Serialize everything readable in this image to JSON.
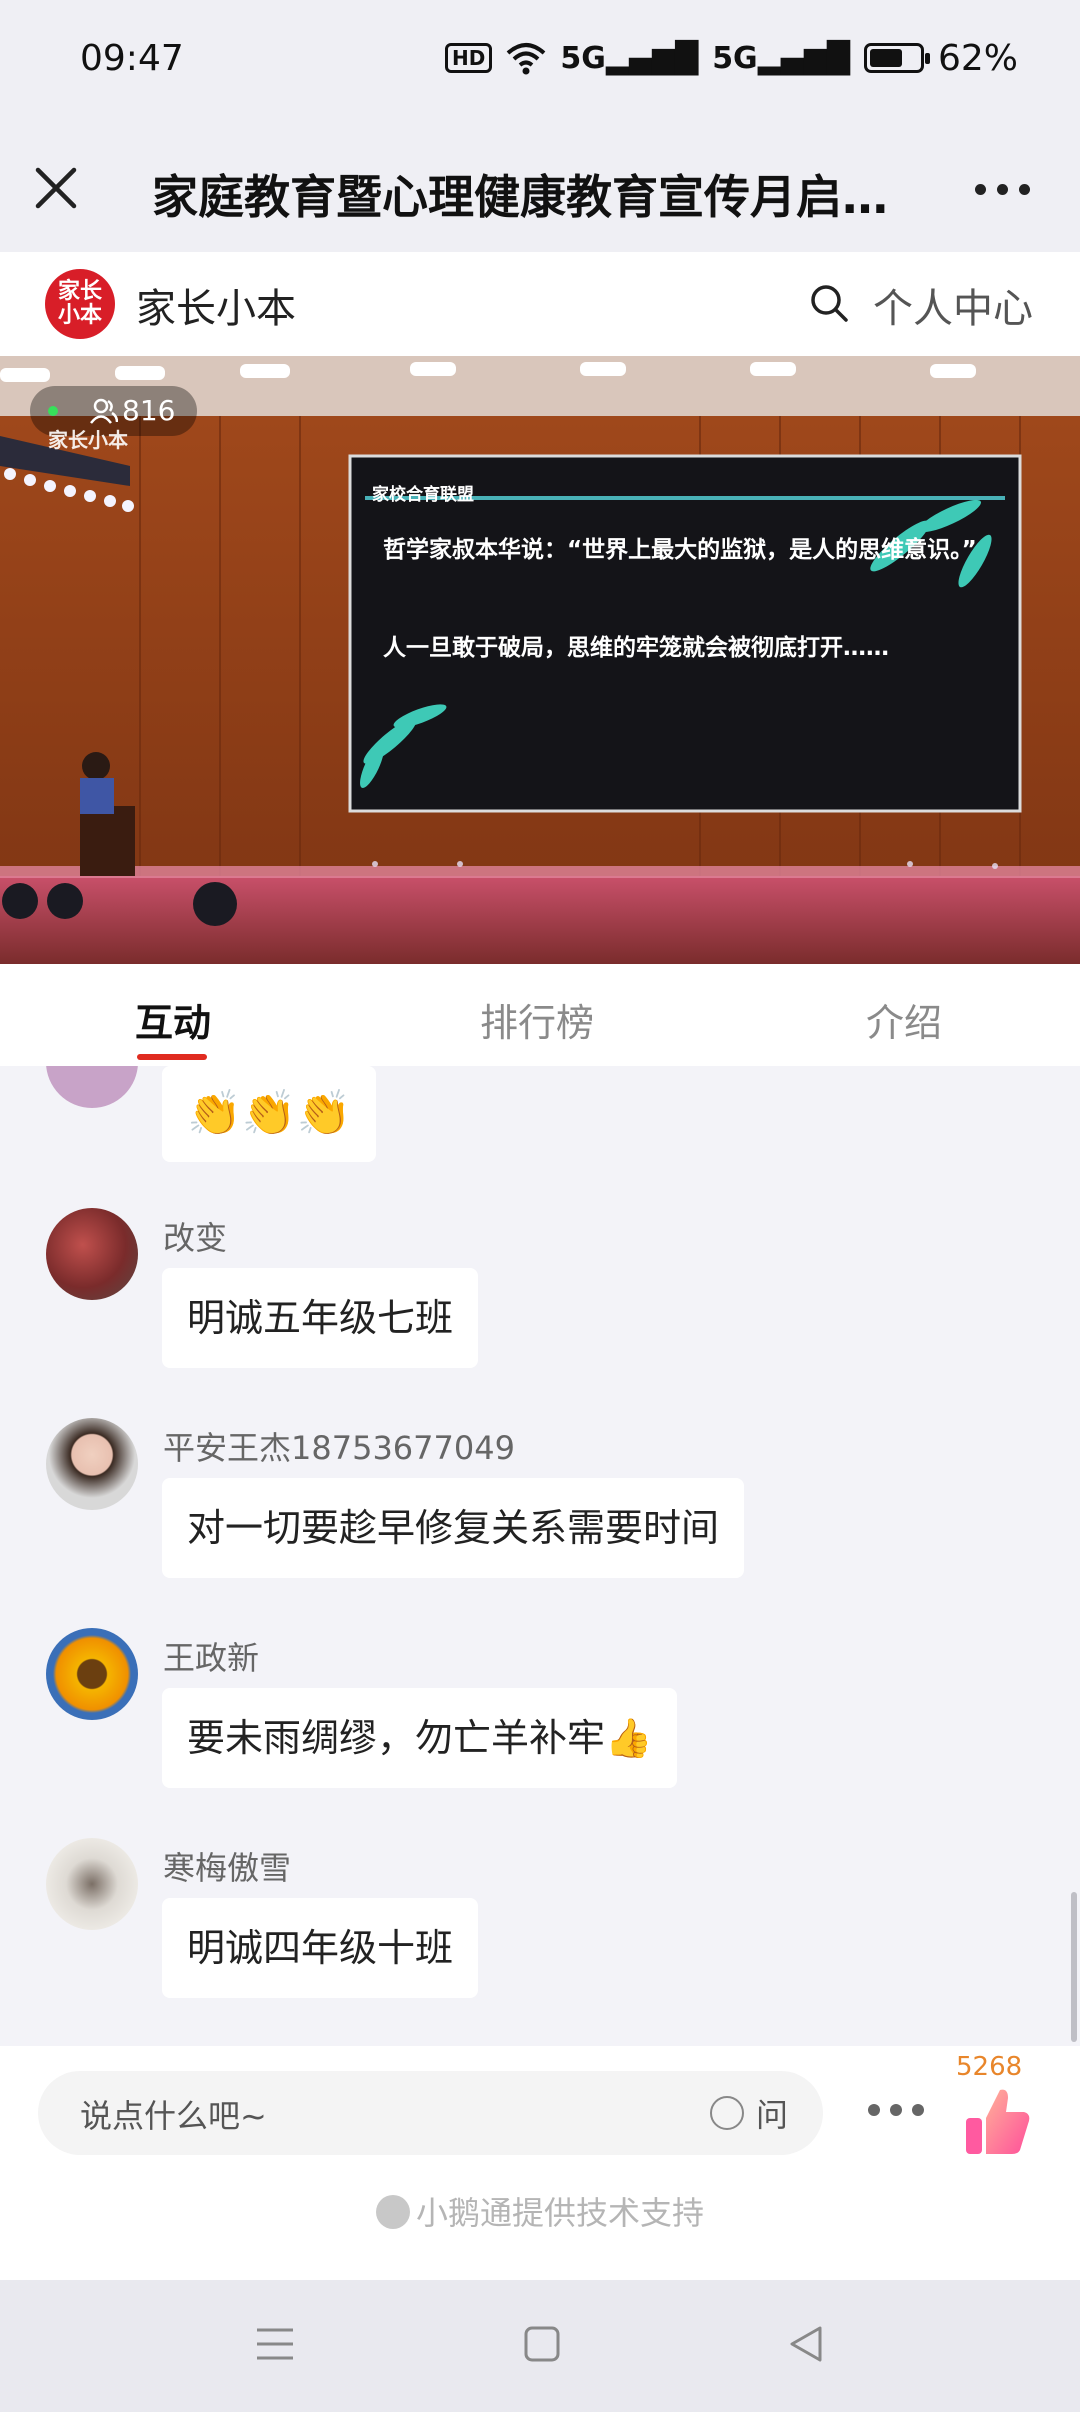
{
  "status_bar": {
    "time": "09:47",
    "hd": "HD",
    "net1": "5G",
    "net2": "5G",
    "battery": "62%"
  },
  "title_bar": {
    "title": "家庭教育暨心理健康教育宣传月启动..."
  },
  "channel": {
    "logo_text_line1": "家长",
    "logo_text_line2": "小本",
    "name": "家长小本",
    "personal_center": "个人中心"
  },
  "video": {
    "viewer_count": "816",
    "watermark": "家长小本",
    "screen_header": "家校合育联盟",
    "screen_text_1": "哲学家叔本华说：“世界上最大的监狱，是人的思维意识。”",
    "screen_text_2": "人一旦敢于破局，思维的牢笼就会被彻底打开……"
  },
  "tabs": [
    {
      "label": "互动"
    },
    {
      "label": "排行榜"
    },
    {
      "label": "介绍"
    }
  ],
  "messages": [
    {
      "user": "",
      "text": "👏👏👏"
    },
    {
      "user": "改变",
      "text": "明诚五年级七班"
    },
    {
      "user": "平安王杰18753677049",
      "text": "对一切要趁早修复关系需要时间"
    },
    {
      "user": "王政新",
      "text": "要未雨绸缪，勿亡羊补牢👍"
    },
    {
      "user": "寒梅傲雪",
      "text": "明诚四年级十班"
    }
  ],
  "input": {
    "placeholder": "说点什么吧~",
    "ask_label": "问"
  },
  "likes": {
    "count": "5268"
  },
  "footer": {
    "powered_by": "小鹅通提供技术支持"
  },
  "colors": {
    "accent_red": "#e02b20",
    "like_orange": "#e8862b",
    "logo_red": "#d81e28"
  }
}
